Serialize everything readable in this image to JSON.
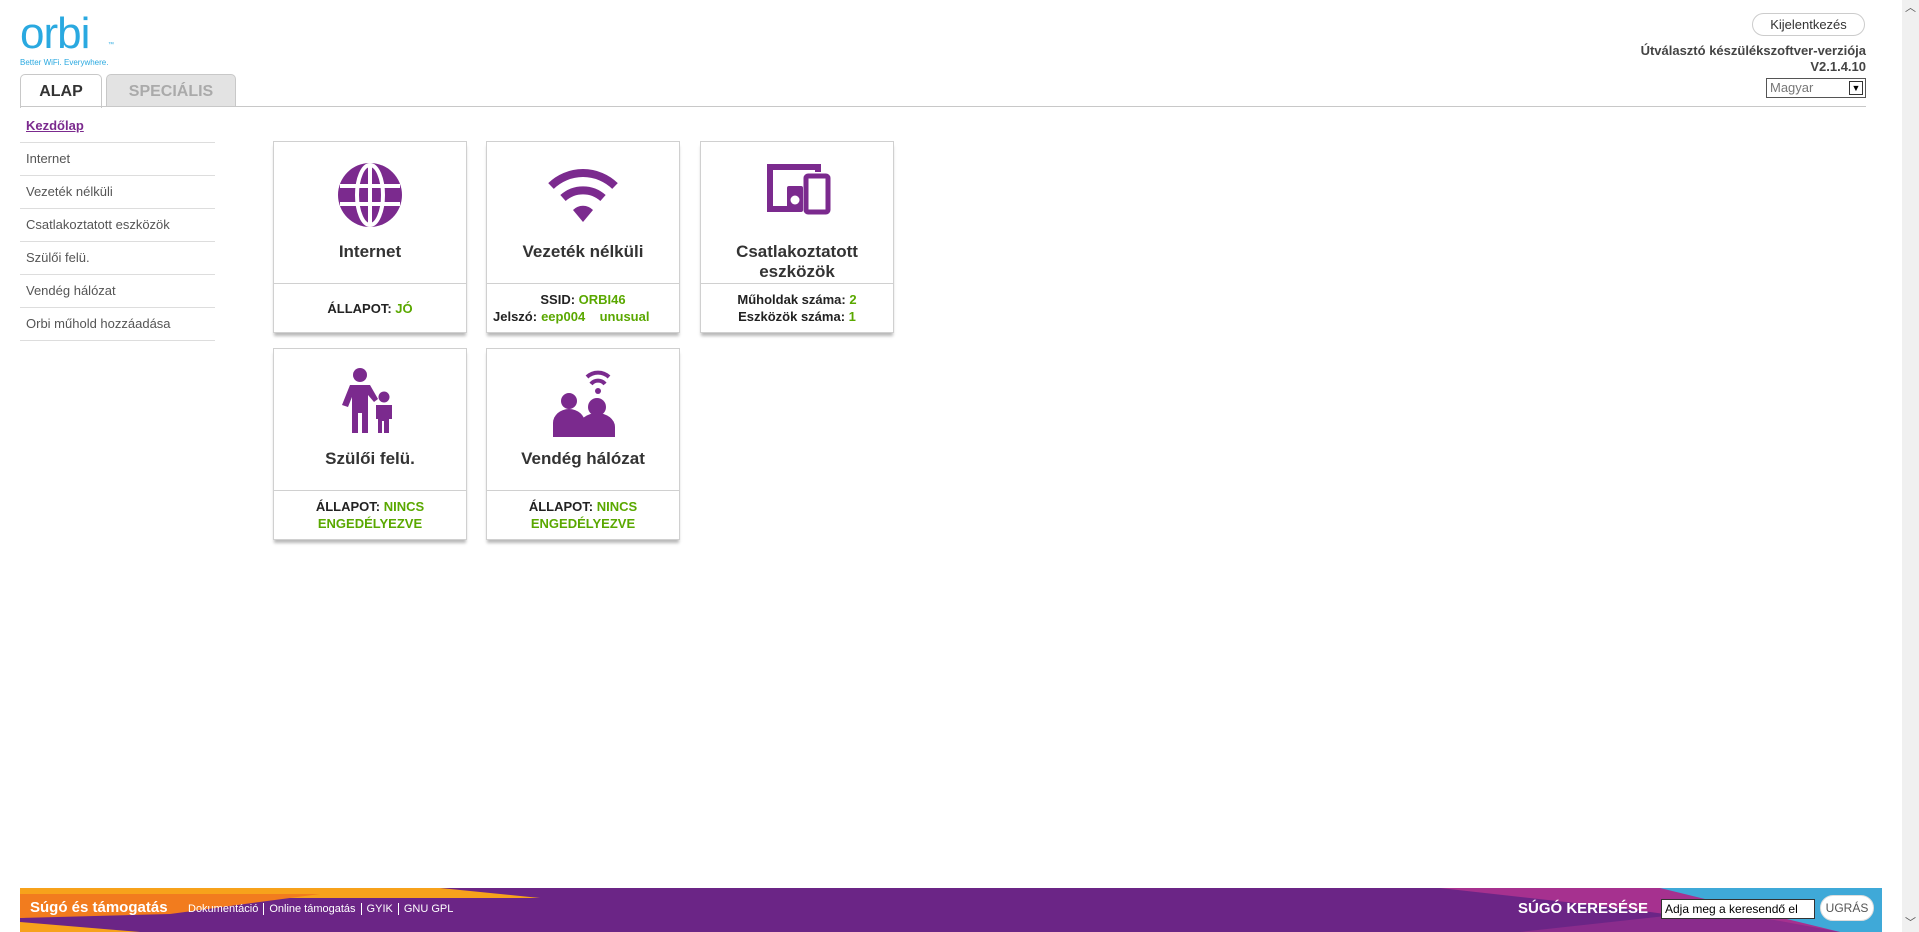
{
  "logo": {
    "word": "orbi",
    "tm": "™",
    "tagline": "Better WiFi. Everywhere."
  },
  "tabs": {
    "basic": "ALAP",
    "advanced": "SPECIÁLIS"
  },
  "header": {
    "logout": "Kijelentkezés",
    "firmware_label": "Útválasztó készülékszoftver-verziója",
    "firmware_version": "V2.1.4.10",
    "language": "Magyar"
  },
  "sidebar": {
    "items": [
      {
        "label": "Kezdőlap",
        "active": true
      },
      {
        "label": "Internet"
      },
      {
        "label": "Vezeték nélküli"
      },
      {
        "label": "Csatlakoztatott eszközök"
      },
      {
        "label": "Szülői felü."
      },
      {
        "label": "Vendég hálózat"
      },
      {
        "label": "Orbi műhold hozzáadása"
      }
    ]
  },
  "cards": {
    "internet": {
      "title": "Internet",
      "status_label": "ÁLLAPOT:",
      "status_value": "JÓ"
    },
    "wireless": {
      "title": "Vezeték nélküli",
      "ssid_label": "SSID:",
      "ssid_value": "ORBI46",
      "pw_label": "Jelszó:",
      "pw_value": "eep004    unusual"
    },
    "devices": {
      "title": "Csatlakoztatott eszközök",
      "sat_label": "Műholdak száma:",
      "sat_value": "2",
      "dev_label": "Eszközök száma:",
      "dev_value": "1"
    },
    "parental": {
      "title": "Szülői felü.",
      "status_label": "ÁLLAPOT:",
      "status_value_1": "NINCS",
      "status_value_2": "ENGEDÉLYEZVE"
    },
    "guest": {
      "title": "Vendég hálózat",
      "status_label": "ÁLLAPOT:",
      "status_value_1": "NINCS",
      "status_value_2": "ENGEDÉLYEZVE"
    }
  },
  "footer": {
    "title": "Súgó és támogatás",
    "links": [
      "Dokumentáció",
      "Online támogatás",
      "GYIK",
      "GNU GPL"
    ],
    "search_label": "SÚGÓ KERESÉSE",
    "search_placeholder": "Adja meg a keresendő el",
    "go_button": "UGRÁS"
  },
  "colors": {
    "brand_blue": "#2aa9e0",
    "purple": "#7b2a8e",
    "green": "#5aa800",
    "orange": "#f7941d"
  },
  "icons": {
    "internet": "globe-icon",
    "wireless": "wifi-icon",
    "devices": "devices-icon",
    "parental": "parent-child-icon",
    "guest": "guest-wifi-icon"
  }
}
